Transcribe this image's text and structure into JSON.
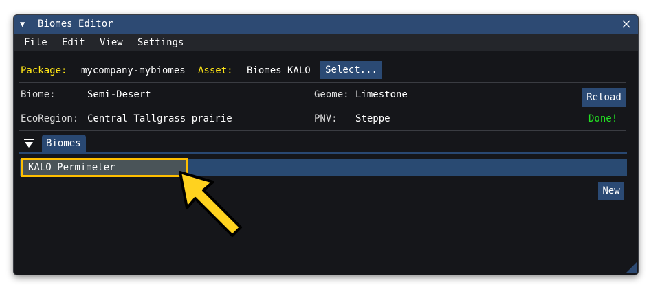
{
  "window": {
    "title": "Biomes Editor"
  },
  "menu": {
    "items": [
      "File",
      "Edit",
      "View",
      "Settings"
    ]
  },
  "package_row": {
    "package_label": "Package:",
    "package_value": "mycompany-mybiomes",
    "asset_label": "Asset:",
    "asset_value": "Biomes_KALO",
    "select_button": "Select..."
  },
  "info": {
    "biome_label": "Biome:",
    "biome_value": "Semi-Desert",
    "geome_label": "Geome:",
    "geome_value": "Limestone",
    "reload_button": "Reload",
    "ecoregion_label": "EcoRegion:",
    "ecoregion_value": "Central Tallgrass prairie",
    "pnv_label": "PNV:",
    "pnv_value": "Steppe",
    "status": "Done!"
  },
  "biomes_tab": {
    "label": "Biomes",
    "items": [
      "KALO Permimeter"
    ],
    "new_button": "New"
  },
  "colors": {
    "title_bar": "#2d4a73",
    "window_bg": "#15161a",
    "label_yellow": "#ffe617",
    "status_green": "#22e022",
    "highlight_border": "#ffbf00",
    "button_bg": "#2b4a74"
  },
  "icons": {
    "title_collapse": "triangle-down-icon",
    "close": "close-icon",
    "tab_collapse": "collapse-arrow-icon",
    "resize": "resize-grip-icon",
    "callout": "callout-arrow-icon"
  }
}
